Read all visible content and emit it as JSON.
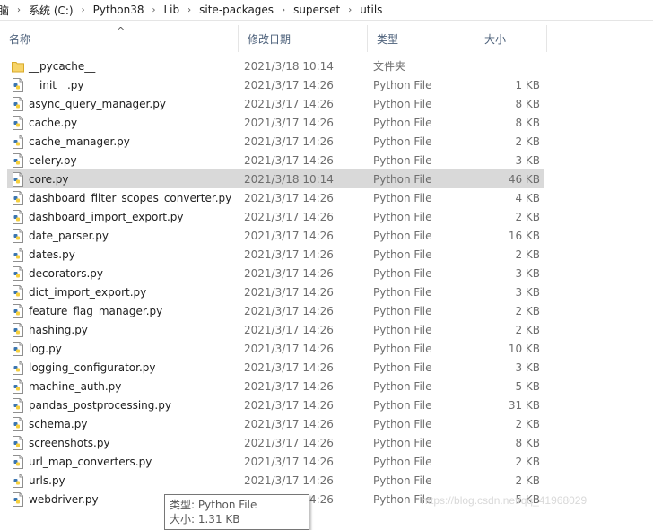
{
  "breadcrumb": [
    "脑",
    "系统 (C:)",
    "Python38",
    "Lib",
    "site-packages",
    "superset",
    "utils"
  ],
  "columns": {
    "name": "名称",
    "date": "修改日期",
    "type": "类型",
    "size": "大小"
  },
  "files": [
    {
      "name": "__pycache__",
      "date": "2021/3/18 10:14",
      "type": "文件夹",
      "size": "",
      "kind": "folder-icon"
    },
    {
      "name": "__init__.py",
      "date": "2021/3/17 14:26",
      "type": "Python File",
      "size": "1 KB",
      "kind": "python-file-icon"
    },
    {
      "name": "async_query_manager.py",
      "date": "2021/3/17 14:26",
      "type": "Python File",
      "size": "8 KB",
      "kind": "python-file-icon"
    },
    {
      "name": "cache.py",
      "date": "2021/3/17 14:26",
      "type": "Python File",
      "size": "8 KB",
      "kind": "python-file-icon"
    },
    {
      "name": "cache_manager.py",
      "date": "2021/3/17 14:26",
      "type": "Python File",
      "size": "2 KB",
      "kind": "python-file-icon"
    },
    {
      "name": "celery.py",
      "date": "2021/3/17 14:26",
      "type": "Python File",
      "size": "3 KB",
      "kind": "python-file-icon"
    },
    {
      "name": "core.py",
      "date": "2021/3/18 10:14",
      "type": "Python File",
      "size": "46 KB",
      "kind": "python-file-icon",
      "selected": true
    },
    {
      "name": "dashboard_filter_scopes_converter.py",
      "date": "2021/3/17 14:26",
      "type": "Python File",
      "size": "4 KB",
      "kind": "python-file-icon"
    },
    {
      "name": "dashboard_import_export.py",
      "date": "2021/3/17 14:26",
      "type": "Python File",
      "size": "2 KB",
      "kind": "python-file-icon"
    },
    {
      "name": "date_parser.py",
      "date": "2021/3/17 14:26",
      "type": "Python File",
      "size": "16 KB",
      "kind": "python-file-icon"
    },
    {
      "name": "dates.py",
      "date": "2021/3/17 14:26",
      "type": "Python File",
      "size": "2 KB",
      "kind": "python-file-icon"
    },
    {
      "name": "decorators.py",
      "date": "2021/3/17 14:26",
      "type": "Python File",
      "size": "3 KB",
      "kind": "python-file-icon"
    },
    {
      "name": "dict_import_export.py",
      "date": "2021/3/17 14:26",
      "type": "Python File",
      "size": "3 KB",
      "kind": "python-file-icon"
    },
    {
      "name": "feature_flag_manager.py",
      "date": "2021/3/17 14:26",
      "type": "Python File",
      "size": "2 KB",
      "kind": "python-file-icon"
    },
    {
      "name": "hashing.py",
      "date": "2021/3/17 14:26",
      "type": "Python File",
      "size": "2 KB",
      "kind": "python-file-icon"
    },
    {
      "name": "log.py",
      "date": "2021/3/17 14:26",
      "type": "Python File",
      "size": "10 KB",
      "kind": "python-file-icon"
    },
    {
      "name": "logging_configurator.py",
      "date": "2021/3/17 14:26",
      "type": "Python File",
      "size": "3 KB",
      "kind": "python-file-icon"
    },
    {
      "name": "machine_auth.py",
      "date": "2021/3/17 14:26",
      "type": "Python File",
      "size": "5 KB",
      "kind": "python-file-icon"
    },
    {
      "name": "pandas_postprocessing.py",
      "date": "2021/3/17 14:26",
      "type": "Python File",
      "size": "31 KB",
      "kind": "python-file-icon"
    },
    {
      "name": "schema.py",
      "date": "2021/3/17 14:26",
      "type": "Python File",
      "size": "2 KB",
      "kind": "python-file-icon"
    },
    {
      "name": "screenshots.py",
      "date": "2021/3/17 14:26",
      "type": "Python File",
      "size": "8 KB",
      "kind": "python-file-icon"
    },
    {
      "name": "url_map_converters.py",
      "date": "2021/3/17 14:26",
      "type": "Python File",
      "size": "2 KB",
      "kind": "python-file-icon"
    },
    {
      "name": "urls.py",
      "date": "2021/3/17 14:26",
      "type": "Python File",
      "size": "2 KB",
      "kind": "python-file-icon"
    },
    {
      "name": "webdriver.py",
      "date": "2021/3/17 14:26",
      "type": "Python File",
      "size": "5 KB",
      "kind": "python-file-icon"
    }
  ],
  "tooltip": {
    "type_line": "类型: Python File",
    "size_line": "大小: 1.31 KB"
  },
  "watermark": "https://blog.csdn.net/qq_41968029",
  "colors": {
    "selected_row": "#d9d9d9",
    "header_text": "#4c607a",
    "meta_text": "#6d6d6d",
    "folder": "#f7d469",
    "python_blue": "#3a75b0",
    "python_yellow": "#f5cf3e"
  }
}
